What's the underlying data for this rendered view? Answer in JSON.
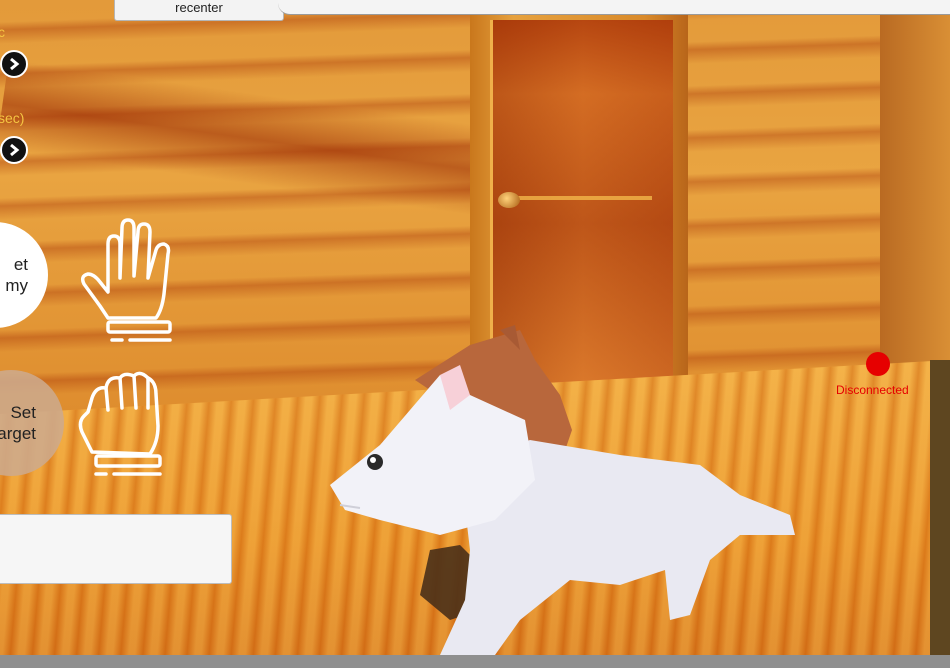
{
  "toolbar": {
    "recenter_label": "recenter"
  },
  "left_panel": {
    "slider1_label": "c",
    "slider2_label": "sec)",
    "set_enemy_label_line1": "et",
    "set_enemy_label_line2": "my",
    "set_target_label_line1": "Set",
    "set_target_label_line2": "arget",
    "open_hand_icon": "open-hand-icon",
    "closed_hand_icon": "fist-hand-icon"
  },
  "text_box": {
    "value": ""
  },
  "status": {
    "text": "Disconnected",
    "color": "#e60000"
  },
  "colors": {
    "label_accent": "#f5c542",
    "status_red": "#e60000"
  }
}
